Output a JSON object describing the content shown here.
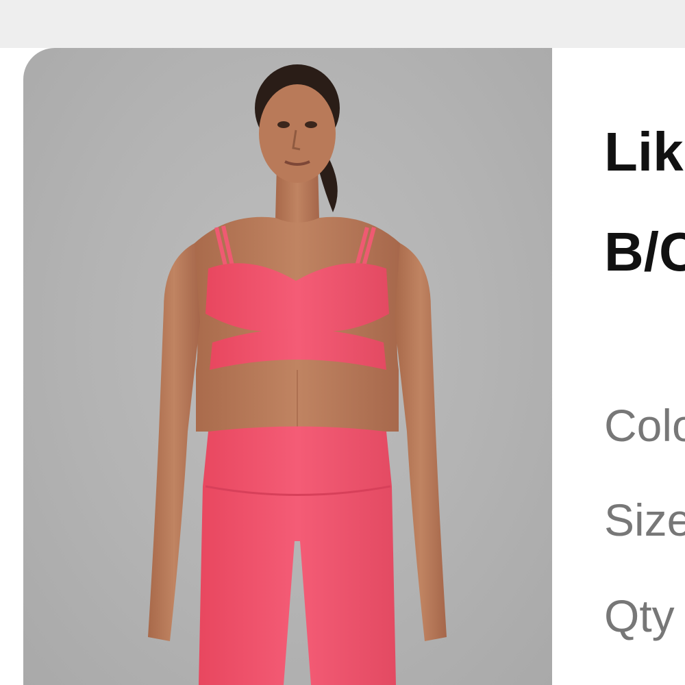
{
  "product": {
    "title_line_1": "Lik",
    "title_line_2": "B/C",
    "image_alt": "Model wearing pink sports bra and high-rise leggings"
  },
  "attributes": {
    "color_label": "Colo",
    "size_label": "Size",
    "qty_label": "Qty"
  },
  "colors": {
    "photo_background": "#b3b3b3",
    "garment_pink": "#f0526f",
    "page_background": "#ffffff",
    "title_text": "#111111",
    "attribute_text": "#777777"
  }
}
